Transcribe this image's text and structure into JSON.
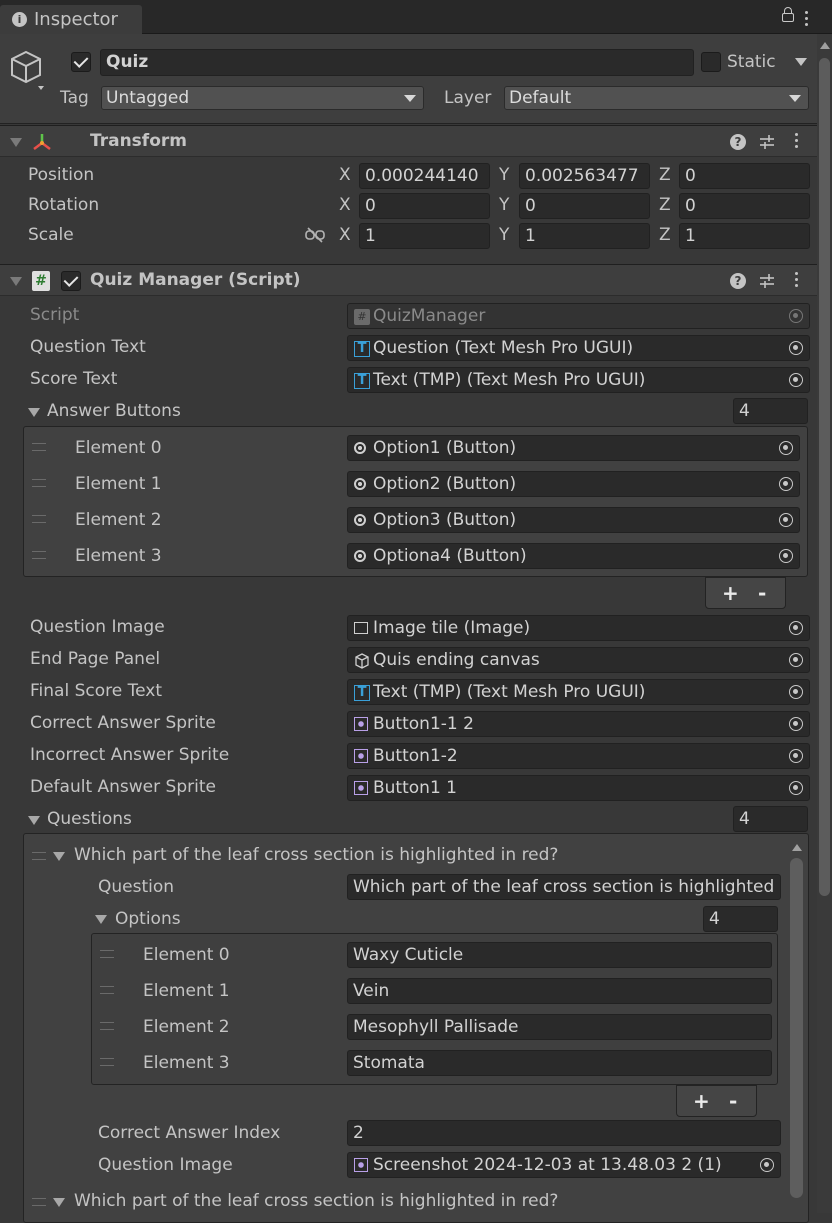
{
  "tab": {
    "title": "Inspector"
  },
  "object": {
    "name": "Quiz",
    "active": true,
    "static_label": "Static",
    "tag_label": "Tag",
    "tag_value": "Untagged",
    "layer_label": "Layer",
    "layer_value": "Default"
  },
  "transform": {
    "title": "Transform",
    "rows": [
      {
        "label": "Position",
        "x": "0.000244140",
        "y": "0.002563477",
        "z": "0"
      },
      {
        "label": "Rotation",
        "x": "0",
        "y": "0",
        "z": "0"
      },
      {
        "label": "Scale",
        "x": "1",
        "y": "1",
        "z": "1"
      }
    ],
    "axis": {
      "x": "X",
      "y": "Y",
      "z": "Z"
    }
  },
  "script": {
    "title": "Quiz Manager (Script)",
    "script_label": "Script",
    "script_value": "QuizManager",
    "question_text_label": "Question Text",
    "question_text_value": "Question (Text Mesh Pro UGUI)",
    "score_text_label": "Score Text",
    "score_text_value": "Text (TMP) (Text Mesh Pro UGUI)",
    "answer_buttons_label": "Answer Buttons",
    "answer_buttons_count": "4",
    "answer_buttons": [
      {
        "label": "Element 0",
        "value": "Option1 (Button)"
      },
      {
        "label": "Element 1",
        "value": "Option2 (Button)"
      },
      {
        "label": "Element 2",
        "value": "Option3 (Button)"
      },
      {
        "label": "Element 3",
        "value": "Optiona4 (Button)"
      }
    ],
    "plus": "+",
    "minus": "-",
    "question_image_label": "Question Image",
    "question_image_value": "Image tile (Image)",
    "end_page_label": "End Page Panel",
    "end_page_value": "Quis ending canvas",
    "final_score_label": "Final Score Text",
    "final_score_value": "Text (TMP) (Text Mesh Pro UGUI)",
    "correct_sprite_label": "Correct Answer Sprite",
    "correct_sprite_value": "Button1-1 2",
    "incorrect_sprite_label": "Incorrect Answer Sprite",
    "incorrect_sprite_value": "Button1-2",
    "default_sprite_label": "Default Answer Sprite",
    "default_sprite_value": "Button1 1",
    "questions_label": "Questions",
    "questions_count": "4",
    "question0": {
      "header": "Which part of the leaf cross section is highlighted in red?",
      "question_label": "Question",
      "question_value": "Which part of the leaf cross section is highlighted",
      "options_label": "Options",
      "options_count": "4",
      "options": [
        {
          "label": "Element 0",
          "value": "Waxy Cuticle"
        },
        {
          "label": "Element 1",
          "value": "Vein"
        },
        {
          "label": "Element 2",
          "value": "Mesophyll Pallisade"
        },
        {
          "label": "Element 3",
          "value": "Stomata"
        }
      ],
      "correct_index_label": "Correct Answer Index",
      "correct_index_value": "2",
      "image_label": "Question Image",
      "image_value": "Screenshot 2024-12-03 at 13.48.03 2 (1)"
    },
    "question1": {
      "header": "Which part of the leaf cross section is highlighted in red?"
    }
  }
}
